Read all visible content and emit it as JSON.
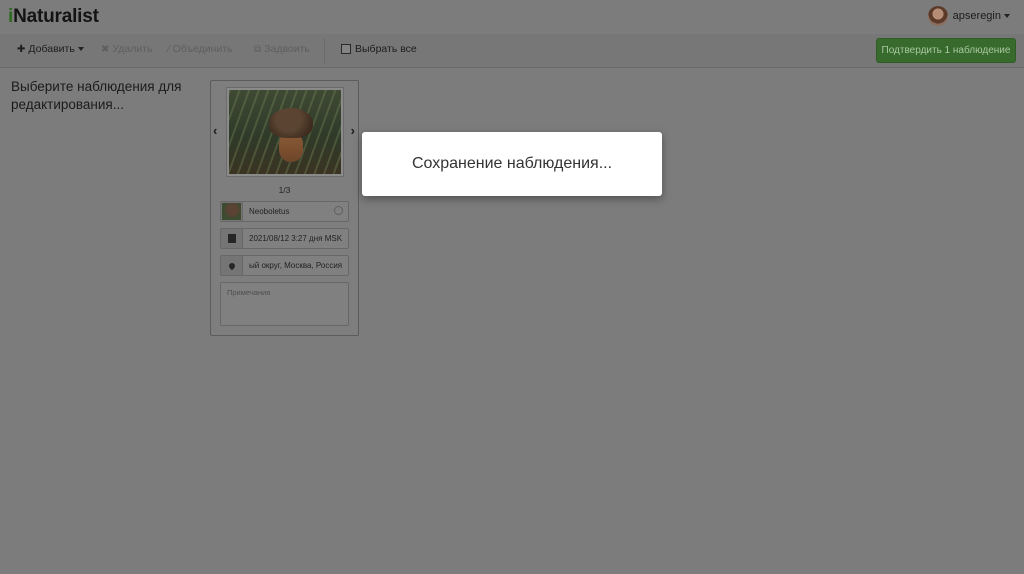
{
  "app": {
    "logo_prefix": "i",
    "logo_rest": "Naturalist"
  },
  "header": {
    "username": "apseregin"
  },
  "toolbar": {
    "add_label": "Добавить",
    "delete_label": "Удалить",
    "merge_label": "Объединить",
    "duplicate_label": "Задвоить",
    "select_all_label": "Выбрать все",
    "confirm_label": "Подтвердить 1 наблюдение"
  },
  "main": {
    "hint": "Выберите наблюдения для редактирования..."
  },
  "card": {
    "photo_counter": "1/3",
    "taxon": "Neoboletus",
    "datetime": "2021/08/12 3:27 дня MSK",
    "place": "ый округ, Москва, Россия",
    "notes_placeholder": "Примечания"
  },
  "modal": {
    "message": "Сохранение наблюдения..."
  },
  "colors": {
    "accent_green": "#376a2c",
    "overlay": "#7c7c7c"
  }
}
